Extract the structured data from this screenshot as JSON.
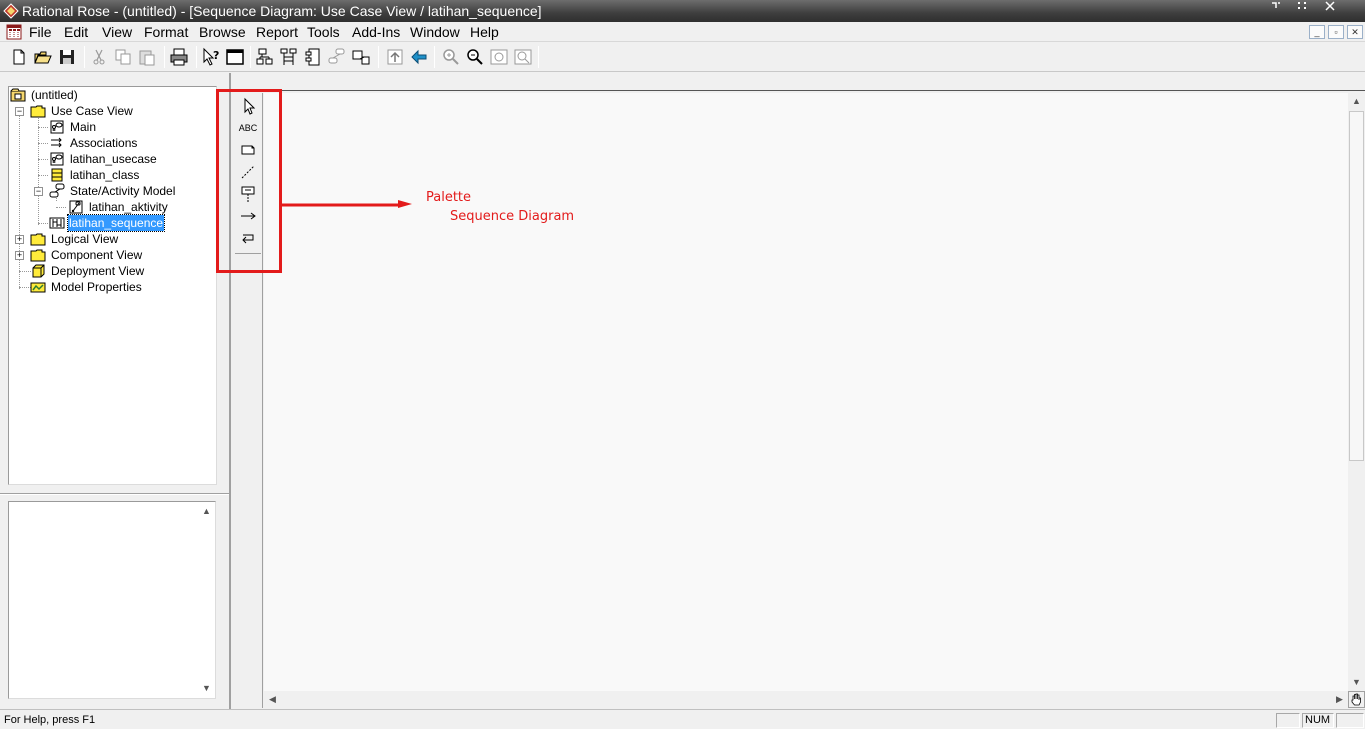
{
  "window": {
    "title": "Rational Rose - (untitled) - [Sequence Diagram: Use Case View / latihan_sequence]"
  },
  "menu": [
    "File",
    "Edit",
    "View",
    "Format",
    "Browse",
    "Report",
    "Tools",
    "Add-Ins",
    "Window",
    "Help"
  ],
  "tree": {
    "root": "(untitled)",
    "use_case_view": "Use Case View",
    "main": "Main",
    "associations": "Associations",
    "latihan_usecase": "latihan_usecase",
    "latihan_class": "latihan_class",
    "state_activity_model": "State/Activity Model",
    "latihan_aktivity": "latihan_aktivity",
    "latihan_sequence": "latihan_sequence",
    "logical_view": "Logical View",
    "component_view": "Component View",
    "deployment_view": "Deployment View",
    "model_properties": "Model Properties"
  },
  "palette": {
    "text_tool_label": "ABC"
  },
  "annotation": {
    "label1": "Palette",
    "label2": "Sequence Diagram",
    "color": "#e31b1b"
  },
  "status": {
    "help_text": "For Help, press F1",
    "num_indicator": "NUM"
  }
}
